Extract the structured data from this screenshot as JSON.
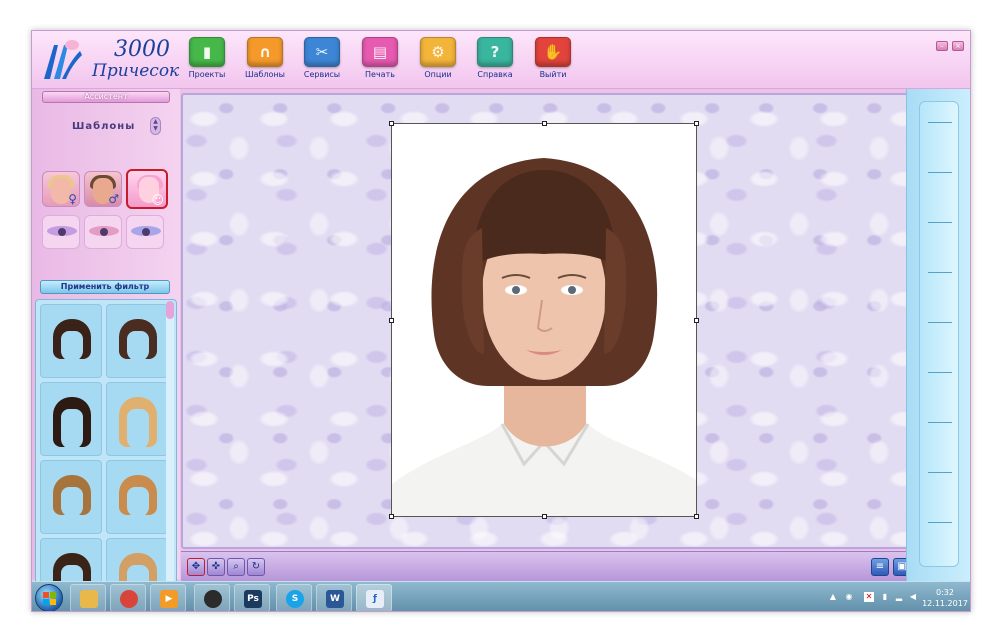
{
  "app": {
    "logo": {
      "line1": "3000",
      "line2": "Причесок"
    },
    "toolbar": [
      {
        "label": "Проекты",
        "icon": "projects-icon",
        "color": "#46b84a"
      },
      {
        "label": "Шаблоны",
        "icon": "templates-icon",
        "color": "#f59a2a"
      },
      {
        "label": "Сервисы",
        "icon": "services-icon",
        "color": "#3d86d6"
      },
      {
        "label": "Печать",
        "icon": "print-icon",
        "color": "#e65ab0"
      },
      {
        "label": "Опции",
        "icon": "options-icon",
        "color": "#f3b43a"
      },
      {
        "label": "Справка",
        "icon": "help-icon",
        "color": "#3ab59e"
      },
      {
        "label": "Выйти",
        "icon": "exit-icon",
        "color": "#e2433c"
      }
    ]
  },
  "left_panel": {
    "assistant_label": "Ассистент",
    "section_title": "Шаблоны",
    "apply_filter_label": "Применить фильтр"
  },
  "taskbar": {
    "time": "0:32",
    "date": "12.11.2017",
    "items": [
      {
        "name": "file-explorer-icon",
        "text": "",
        "color": "#e8b84a"
      },
      {
        "name": "chrome-icon",
        "text": "",
        "color": "#d9443a"
      },
      {
        "name": "media-player-icon",
        "text": "",
        "color": "#f29b27"
      },
      {
        "name": "obs-icon",
        "text": "",
        "color": "#2b2b2b"
      },
      {
        "name": "photoshop-icon",
        "text": "Ps",
        "color": "#1c3a5e"
      },
      {
        "name": "skype-icon",
        "text": "S",
        "color": "#1aa3e8"
      },
      {
        "name": "word-icon",
        "text": "W",
        "color": "#2b5797"
      },
      {
        "name": "hairstyles-app-icon",
        "text": "",
        "color": "#e8eef8"
      }
    ]
  }
}
